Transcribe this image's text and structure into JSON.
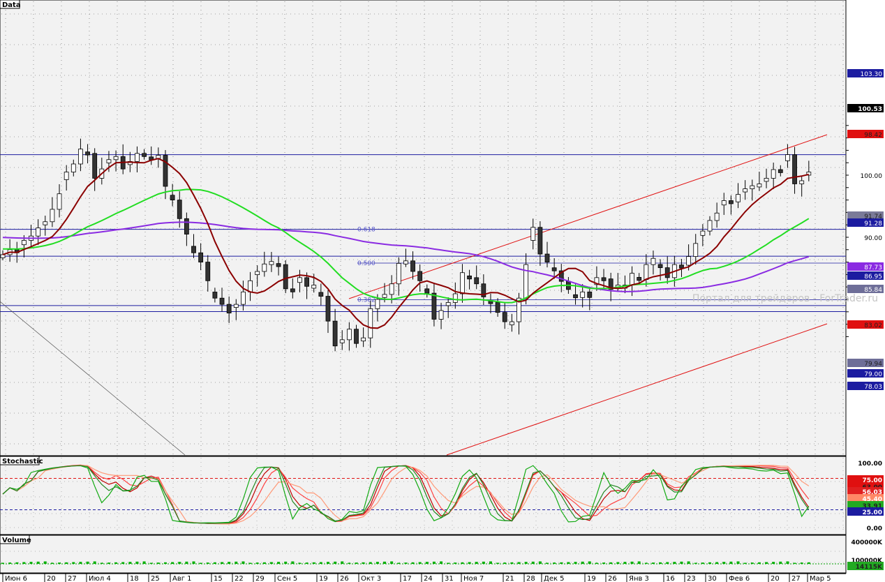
{
  "panels": {
    "price": "Data",
    "stochastic": "Stochastic",
    "volume": "Volume"
  },
  "watermark": "Портал для трейдеров - ForTrader.ru",
  "chart_data": [
    {
      "type": "candlestick",
      "panel": "price",
      "title": "Data",
      "ylim": [
        72,
        108.5
      ],
      "yticks": [
        "100.00",
        "90.00"
      ],
      "xticks": [
        "Июн 6",
        "20",
        "27",
        "Июл 4",
        "18",
        "25",
        "Авг 1",
        "15",
        "22",
        "29",
        "Сен 5",
        "19",
        "26",
        "Окт 3",
        "17",
        "24",
        "31",
        "Ноя 7",
        "21",
        "28",
        "Дек 5",
        "19",
        "26",
        "Янв 3",
        "16",
        "23",
        "30",
        "Фев 6",
        "20",
        "27",
        "Мар 5"
      ],
      "horizontal_levels": [
        103.3,
        91.28,
        86.95,
        79.0,
        78.03
      ],
      "fibonacci": [
        {
          "label": "0.618",
          "value": 91.28
        },
        {
          "label": "0.500",
          "value": 85.84
        },
        {
          "label": "0.382",
          "value": 79.94
        }
      ],
      "price_labels": [
        {
          "text": "103.30",
          "value": 103.3,
          "bg": "#1c1ca0",
          "fg": "#ffffff"
        },
        {
          "text": "100.53",
          "value": 100.53,
          "bg": "#000000",
          "fg": "#ffffff"
        },
        {
          "text": "98.42",
          "value": 98.42,
          "bg": "#e01010",
          "fg": "#202020"
        },
        {
          "text": "91.74",
          "value": 91.74,
          "bg": "#7a7a98",
          "fg": "#202020"
        },
        {
          "text": "91.28",
          "value": 91.28,
          "bg": "#1c1ca0",
          "fg": "#ffffff"
        },
        {
          "text": "87.73",
          "value": 87.73,
          "bg": "#8a2be2",
          "fg": "#ffffff"
        },
        {
          "text": "86.95",
          "value": 86.95,
          "bg": "#1c1ca0",
          "fg": "#ffffff"
        },
        {
          "text": "85.84",
          "value": 85.84,
          "bg": "#6e6e98",
          "fg": "#ffffff"
        },
        {
          "text": "83.02",
          "value": 83.02,
          "bg": "#e01010",
          "fg": "#202020"
        },
        {
          "text": "79.94",
          "value": 79.94,
          "bg": "#6e6e98",
          "fg": "#202020"
        },
        {
          "text": "79.00",
          "value": 79.0,
          "bg": "#1c1ca0",
          "fg": "#ffffff"
        },
        {
          "text": "78.03",
          "value": 78.03,
          "bg": "#1c1ca0",
          "fg": "#ffffff"
        }
      ],
      "series_colors": {
        "ma_fast": "#8b0000",
        "ma_mid": "#22dd22",
        "ma_slow": "#8a2be2",
        "trendline": "#e01010",
        "level": "#1c1ca0"
      },
      "closes": [
        87.2,
        88,
        87.5,
        89.5,
        90.2,
        91.5,
        92.5,
        94.5,
        97,
        100.5,
        101.8,
        104.2,
        103.5,
        99.5,
        101,
        102.5,
        103,
        101,
        102.2,
        103.5,
        103.2,
        102.8,
        103.2,
        98.2,
        96,
        93,
        90.5,
        87.5,
        86,
        83,
        80.2,
        79.2,
        77.8,
        79.2,
        81.2,
        83,
        84.5,
        85.7,
        86.1,
        85.6,
        81.7,
        81.3,
        83.5,
        82.1,
        82.3,
        80.5,
        76.5,
        72.5,
        73.5,
        75.2,
        72.9,
        73.8,
        78.5,
        80,
        80.8,
        82.5,
        85.8,
        86.2,
        84.5,
        83,
        81,
        76.8,
        78.2,
        79.5,
        80.9,
        84.3,
        83.5,
        82.5,
        80.4,
        79.5,
        77.9,
        76.4,
        76.4,
        80.2,
        85.6,
        91.6,
        87.3,
        86,
        84.6,
        82.9,
        81.6,
        80.3,
        81.2,
        80.3,
        83.5,
        83.3,
        81.6,
        82.3,
        82.3,
        84.2,
        83.2,
        85.6,
        86.6,
        85.1,
        83.5,
        85.6,
        85.5,
        86.9,
        89,
        91,
        92.7,
        93.9,
        95.9,
        95.7,
        96.9,
        97.8,
        98.3,
        98.6,
        99.5,
        100.9,
        100.5,
        103.3,
        98.6,
        99.1,
        100.5
      ]
    },
    {
      "type": "line",
      "panel": "stochastic",
      "title": "Stochastic",
      "ylim": [
        0,
        100
      ],
      "yticks": [
        "100.00",
        "0.00"
      ],
      "levels": [
        75,
        25
      ],
      "value_labels": [
        {
          "text": "75.00",
          "value": 75,
          "bg": "#e01010",
          "fg": "#ffffff"
        },
        {
          "text": "63.00",
          "value": 63,
          "bg": "#e01010",
          "fg": "#202020"
        },
        {
          "text": "56.03",
          "value": 56.03,
          "bg": "#e02020",
          "fg": "#ffffff"
        },
        {
          "text": "45.40",
          "value": 45.4,
          "bg": "#ff8866",
          "fg": "#ffffff"
        },
        {
          "text": "33.91",
          "value": 33.91,
          "bg": "#22aa22",
          "fg": "#202020"
        },
        {
          "text": "25.00",
          "value": 25,
          "bg": "#1c1ca0",
          "fg": "#ffffff"
        }
      ],
      "line_colors": [
        "#c00000",
        "#ff4040",
        "#ff9977",
        "#11aa11",
        "#228822"
      ]
    },
    {
      "type": "bar",
      "panel": "volume",
      "title": "Volume",
      "yticks": [
        "400000K",
        "100000K"
      ],
      "value_labels": [
        {
          "text": "14115K",
          "bg": "#22aa22",
          "fg": "#202020"
        }
      ],
      "bar_color": "#00b000"
    }
  ]
}
